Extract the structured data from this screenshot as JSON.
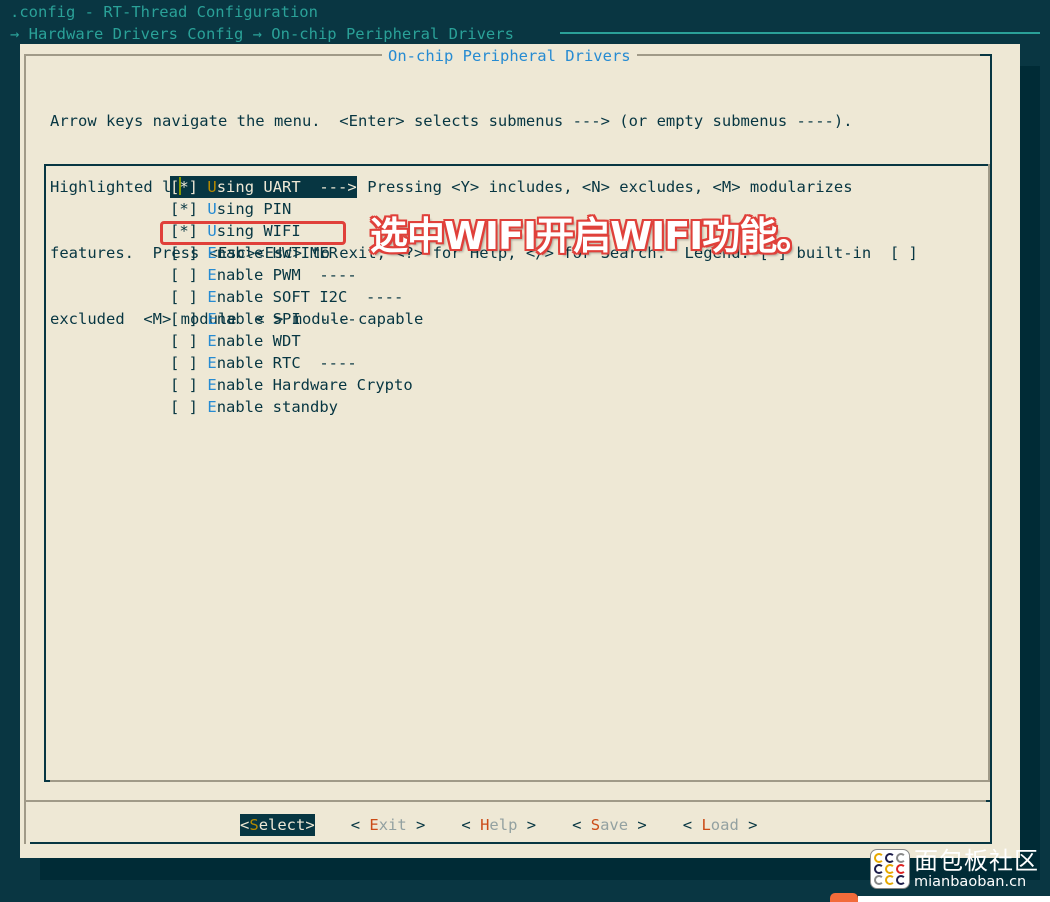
{
  "window": {
    "title": ".config - RT-Thread Configuration",
    "breadcrumb": "→ Hardware Drivers Config → On-chip Peripheral Drivers"
  },
  "dialog": {
    "title": "On-chip Peripheral Drivers",
    "help_lines": [
      "Arrow keys navigate the menu.  <Enter> selects submenus ---> (or empty submenus ----).",
      "Highlighted letters are hotkeys.  Pressing <Y> includes, <N> excludes, <M> modularizes",
      "features.  Press <Esc><Esc> to exit, <?> for Help, </> for Search.  Legend: [*] built-in  [ ]",
      "excluded  <M> module  < > module capable"
    ]
  },
  "menu": {
    "items": [
      {
        "check": "[*]",
        "hotkey": "U",
        "rest": "sing UART  --->",
        "selected": true
      },
      {
        "check": "[*]",
        "hotkey": "U",
        "rest": "sing PIN",
        "selected": false
      },
      {
        "check": "[*]",
        "hotkey": "U",
        "rest": "sing WIFI",
        "selected": false
      },
      {
        "check": "[ ]",
        "hotkey": "E",
        "rest": "nable HWTIMER",
        "selected": false
      },
      {
        "check": "[ ]",
        "hotkey": "E",
        "rest": "nable PWM  ----",
        "selected": false
      },
      {
        "check": "[ ]",
        "hotkey": "E",
        "rest": "nable SOFT I2C  ----",
        "selected": false
      },
      {
        "check": "[ ]",
        "hotkey": "E",
        "rest": "nable SPI  ----",
        "selected": false
      },
      {
        "check": "[ ]",
        "hotkey": "E",
        "rest": "nable WDT",
        "selected": false
      },
      {
        "check": "[ ]",
        "hotkey": "E",
        "rest": "nable RTC  ----",
        "selected": false
      },
      {
        "check": "[ ]",
        "hotkey": "E",
        "rest": "nable Hardware Crypto",
        "selected": false
      },
      {
        "check": "[ ]",
        "hotkey": "E",
        "rest": "nable standby",
        "selected": false
      }
    ]
  },
  "buttons": [
    {
      "open": "<",
      "hotkey": "S",
      "rest": "elect",
      "close": ">",
      "selected": true
    },
    {
      "open": "< ",
      "hotkey": "E",
      "rest": "xit",
      "close": " >",
      "selected": false
    },
    {
      "open": "< ",
      "hotkey": "H",
      "rest": "elp",
      "close": " >",
      "selected": false
    },
    {
      "open": "< ",
      "hotkey": "S",
      "rest": "ave",
      "close": " >",
      "selected": false
    },
    {
      "open": "< ",
      "hotkey": "L",
      "rest": "oad",
      "close": " >",
      "selected": false
    }
  ],
  "annotation": {
    "text": "选中WIFI开启WIFI功能。",
    "color": "#e0403a"
  },
  "watermark": {
    "cn": "面包板社区",
    "en": "mianbaoban.cn"
  },
  "colors": {
    "background": "#093642",
    "dialog_bg": "#eee8d5",
    "title_text": "#2aa198",
    "hotkey_menu": "#268bd2",
    "hotkey_selected": "#b58900",
    "hotkey_button": "#cb4b16"
  }
}
